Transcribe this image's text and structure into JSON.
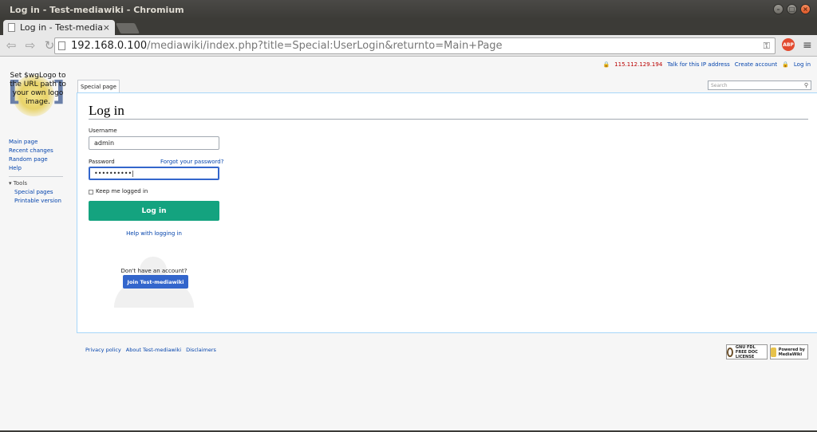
{
  "window": {
    "title": "Log in - Test-mediawiki - Chromium"
  },
  "tab": {
    "label": "Log in - Test-mediawiki",
    "close": "×"
  },
  "address": {
    "host": "192.168.0.100",
    "path": "/mediawiki/index.php?title=Special:UserLogin&returnto=Main+Page"
  },
  "extensions": {
    "abp": "ABP"
  },
  "userlinks": {
    "ip": "115.112.129.194",
    "talk": "Talk for this IP address",
    "create": "Create account",
    "login": "Log in"
  },
  "logo": {
    "text": "Set $wgLogo to the URL path to your own logo image."
  },
  "sidebar": {
    "items": [
      {
        "label": "Main page"
      },
      {
        "label": "Recent changes"
      },
      {
        "label": "Random page"
      },
      {
        "label": "Help"
      }
    ],
    "tools_heading": "Tools",
    "tools": [
      {
        "label": "Special pages"
      },
      {
        "label": "Printable version"
      }
    ]
  },
  "namespace_tab": "Special page",
  "search": {
    "placeholder": "Search"
  },
  "form": {
    "heading": "Log in",
    "username_label": "Username",
    "username_value": "admin",
    "password_label": "Password",
    "forgot_link": "Forgot your password?",
    "password_value": "••••••••••|",
    "keep_logged_in": "Keep me logged in",
    "login_button": "Log in",
    "help_link": "Help with logging in",
    "no_account": "Don't have an account?",
    "join_button": "Join Test-mediawiki"
  },
  "footer": {
    "links": [
      "Privacy policy",
      "About Test-mediawiki",
      "Disclaimers"
    ],
    "gnu_badge": "GNU FDL FREE DOC LICENSE",
    "mw_badge": "Powered by MediaWiki"
  },
  "colors": {
    "login_button": "#14a37f",
    "join_button": "#3366cc",
    "link": "#0645ad"
  }
}
